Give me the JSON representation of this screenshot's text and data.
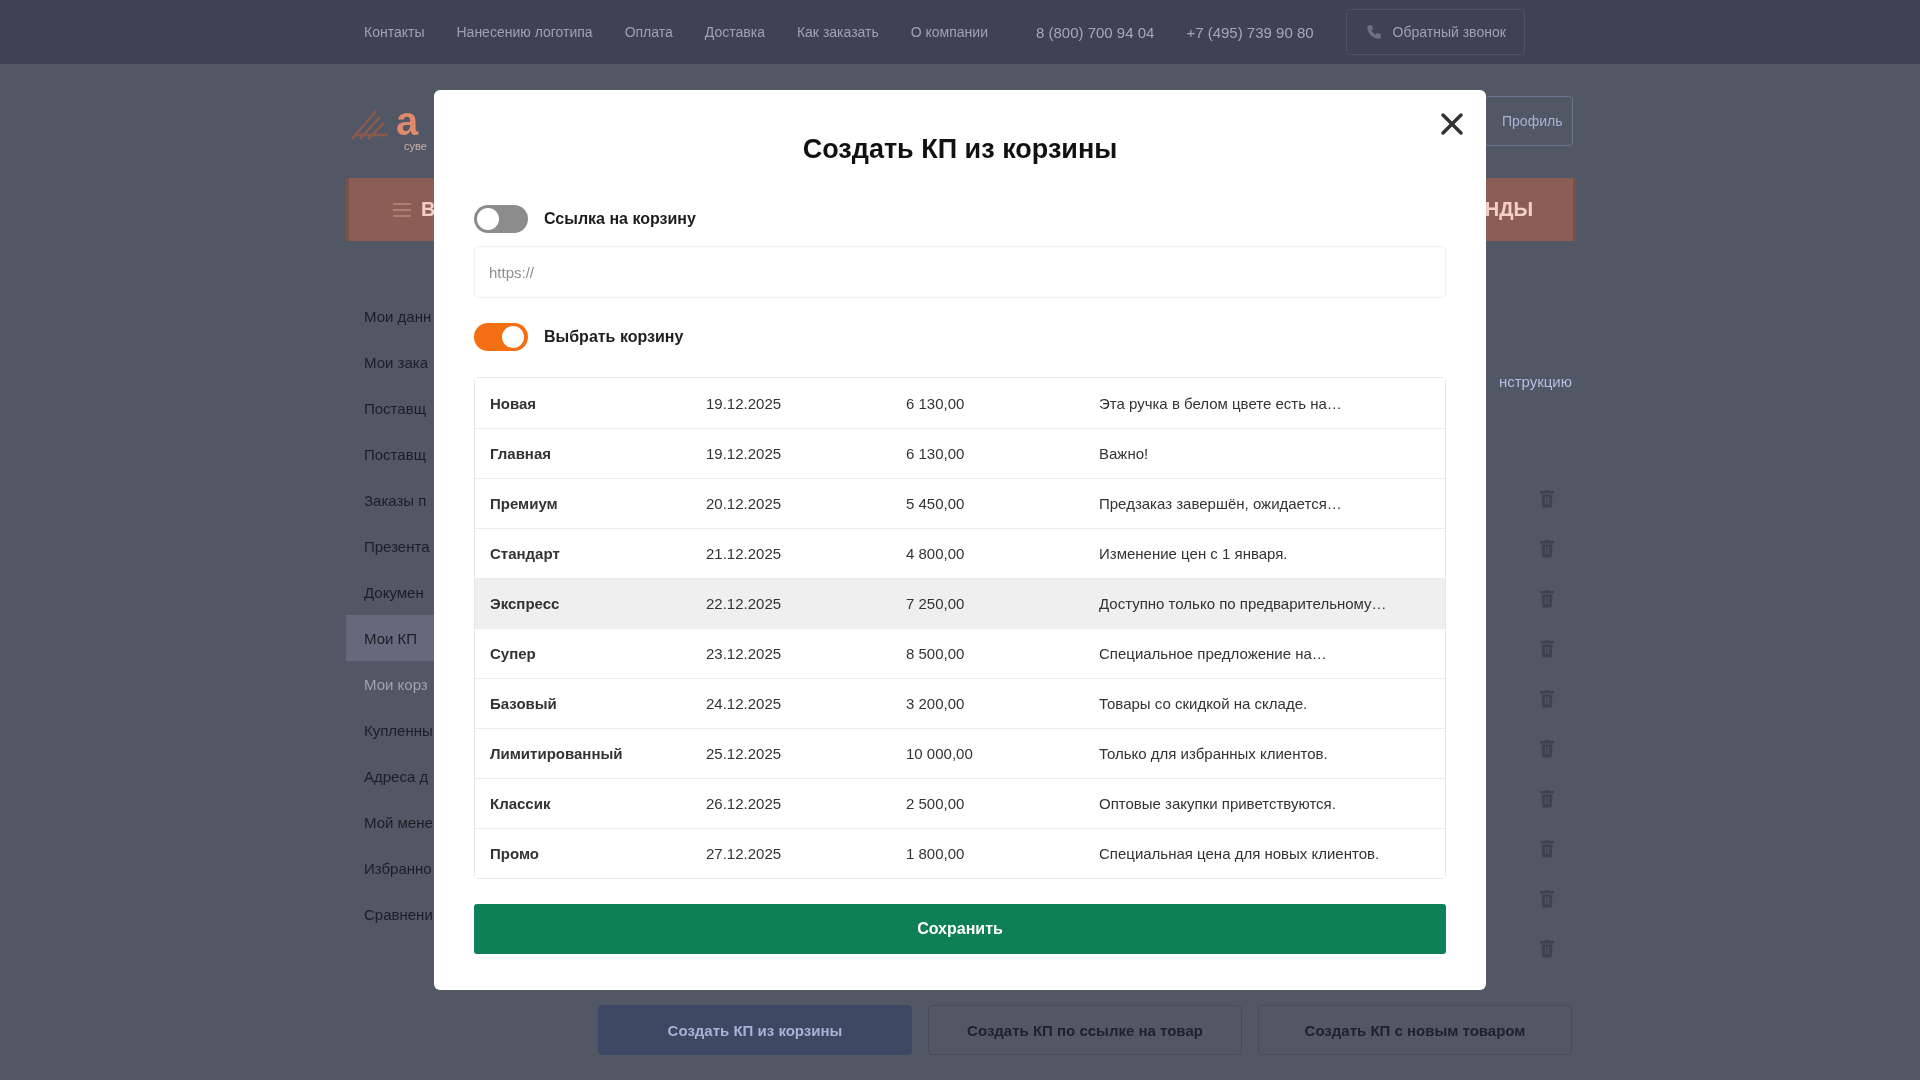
{
  "top_bar": {
    "links": [
      "Контакты",
      "Нанесению логотипа",
      "Оплата",
      "Доставка",
      "Как заказать",
      "О компании"
    ],
    "phones": [
      "8 (800) 700 94 04",
      "+7 (495) 739 90 80"
    ],
    "callback_button": "Обратный звонок"
  },
  "header": {
    "logo_text": "а",
    "logo_subtitle": "суве",
    "profile_button": "Профиль"
  },
  "menu_band": {
    "catalog_label": "В",
    "right_label": "НДЫ"
  },
  "sidebar": {
    "items": [
      {
        "label": "Мои данн",
        "selected": false,
        "faded": false
      },
      {
        "label": "Мои зака",
        "selected": false,
        "faded": false
      },
      {
        "label": "Поставщ",
        "selected": false,
        "faded": false
      },
      {
        "label": "Поставщ",
        "selected": false,
        "faded": false
      },
      {
        "label": "Заказы п",
        "selected": false,
        "faded": false
      },
      {
        "label": "Презента",
        "selected": false,
        "faded": false
      },
      {
        "label": "Докумен",
        "selected": false,
        "faded": false
      },
      {
        "label": "Мои КП",
        "selected": true,
        "faded": false
      },
      {
        "label": "Мои корз",
        "selected": false,
        "faded": true
      },
      {
        "label": "Купленны",
        "selected": false,
        "faded": false
      },
      {
        "label": "Адреса д",
        "selected": false,
        "faded": false
      },
      {
        "label": "Мой мене",
        "selected": false,
        "faded": false
      },
      {
        "label": "Избранно",
        "selected": false,
        "faded": false
      },
      {
        "label": "Сравнени",
        "selected": false,
        "faded": false
      }
    ]
  },
  "instruction_link": "нструкцию",
  "bottom_buttons": [
    {
      "label": "Создать КП из корзины",
      "kind": "filled"
    },
    {
      "label": "Создать КП по ссылке на товар",
      "kind": "outline"
    },
    {
      "label": "Создать КП с новым товаром",
      "kind": "outline"
    }
  ],
  "modal": {
    "title": "Создать КП из корзины",
    "link_toggle": {
      "label": "Ссылка на корзину",
      "on": false
    },
    "link_input": {
      "placeholder": "https://"
    },
    "cart_toggle": {
      "label": "Выбрать корзину",
      "on": true
    },
    "carts": [
      {
        "name": "Новая",
        "date": "19.12.2025",
        "sum": "6 130,00",
        "note": "Эта ручка в белом цвете есть на…",
        "highlighted": false
      },
      {
        "name": "Главная",
        "date": "19.12.2025",
        "sum": "6 130,00",
        "note": "Важно!",
        "highlighted": false
      },
      {
        "name": "Премиум",
        "date": "20.12.2025",
        "sum": "5 450,00",
        "note": "Предзаказ завершён, ожидается…",
        "highlighted": false
      },
      {
        "name": "Стандарт",
        "date": "21.12.2025",
        "sum": "4 800,00",
        "note": "Изменение цен с 1 января.",
        "highlighted": false
      },
      {
        "name": "Экспресс",
        "date": "22.12.2025",
        "sum": "7 250,00",
        "note": "Доступно только по предварительному…",
        "highlighted": true
      },
      {
        "name": "Супер",
        "date": "23.12.2025",
        "sum": "8 500,00",
        "note": "Специальное предложение на…",
        "highlighted": false
      },
      {
        "name": "Базовый",
        "date": "24.12.2025",
        "sum": "3 200,00",
        "note": "Товары со скидкой на складе.",
        "highlighted": false
      },
      {
        "name": "Лимитированный",
        "date": "25.12.2025",
        "sum": "10 000,00",
        "note": "Только для избранных клиентов.",
        "highlighted": false
      },
      {
        "name": "Классик",
        "date": "26.12.2025",
        "sum": "2 500,00",
        "note": "Оптовые закупки приветствуются.",
        "highlighted": false
      },
      {
        "name": "Промо",
        "date": "27.12.2025",
        "sum": "1 800,00",
        "note": "Специальная цена для новых клиентов.",
        "highlighted": false
      }
    ],
    "save_button": "Сохранить"
  }
}
